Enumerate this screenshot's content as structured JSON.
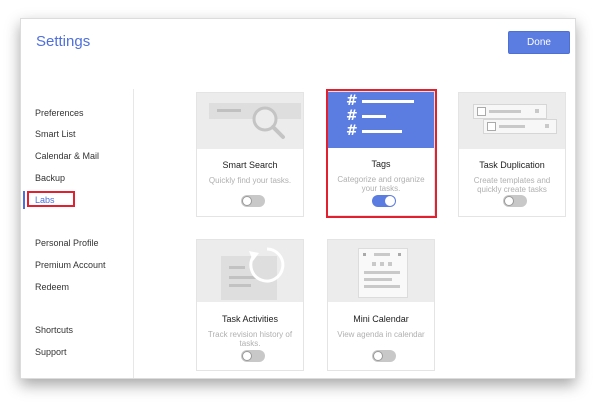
{
  "window": {
    "title": "Settings",
    "done_label": "Done"
  },
  "sidebar": {
    "items": [
      {
        "label": "Preferences"
      },
      {
        "label": "Smart List"
      },
      {
        "label": "Calendar & Mail"
      },
      {
        "label": "Backup"
      },
      {
        "label": "Labs",
        "active": true
      },
      {
        "label": "Personal Profile"
      },
      {
        "label": "Premium Account"
      },
      {
        "label": "Redeem"
      },
      {
        "label": "Shortcuts"
      },
      {
        "label": "Support"
      }
    ]
  },
  "cards": [
    {
      "title": "Smart Search",
      "desc": "Quickly find your tasks.",
      "enabled": false
    },
    {
      "title": "Tags",
      "desc": "Categorize and organize your tasks.",
      "enabled": true
    },
    {
      "title": "Task Duplication",
      "desc": "Create templates and quickly create tasks",
      "enabled": false
    },
    {
      "title": "Task Activities",
      "desc": "Track revision history of tasks.",
      "enabled": false
    },
    {
      "title": "Mini Calendar",
      "desc": "View agenda in calendar",
      "enabled": false
    }
  ],
  "colors": {
    "accent": "#5b7ce0",
    "highlight": "#e2202f"
  }
}
